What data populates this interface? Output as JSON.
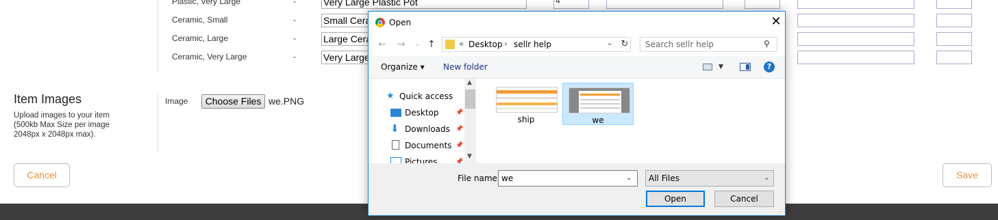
{
  "form": {
    "rows": [
      {
        "label": "Plastic, Very Large",
        "dash": "-",
        "value": "Very Large Plastic Pot",
        "qty": "4"
      },
      {
        "label": "Ceramic, Small",
        "dash": "-",
        "value": "Small Ceramic"
      },
      {
        "label": "Ceramic, Large",
        "dash": "-",
        "value": "Large Ceramic"
      },
      {
        "label": "Ceramic, Very Large",
        "dash": "-",
        "value": "Very Large"
      }
    ],
    "images_title": "Item Images",
    "images_desc": "Upload images to your item (500kb Max Size per image 2048px x 2048px max).",
    "image_label": "Image",
    "choose_files": "Choose Files",
    "chosen_file": "we.PNG",
    "cancel": "Cancel",
    "save": "Save",
    "accent": "#e8923a"
  },
  "dialog": {
    "title": "Open",
    "breadcrumb": [
      "«",
      "Desktop",
      "sellr help"
    ],
    "search_placeholder": "Search sellr help",
    "toolbar": {
      "organize": "Organize ▾",
      "new_folder": "New folder"
    },
    "nav": [
      "Quick access",
      "Desktop",
      "Downloads",
      "Documents",
      "Pictures"
    ],
    "files": [
      {
        "name": "ship",
        "selected": false
      },
      {
        "name": "we",
        "selected": true
      }
    ],
    "file_name_label": "File name:",
    "file_name_value": "we",
    "file_type": "All Files",
    "open": "Open",
    "cancel": "Cancel",
    "accent": "#0078d7"
  }
}
